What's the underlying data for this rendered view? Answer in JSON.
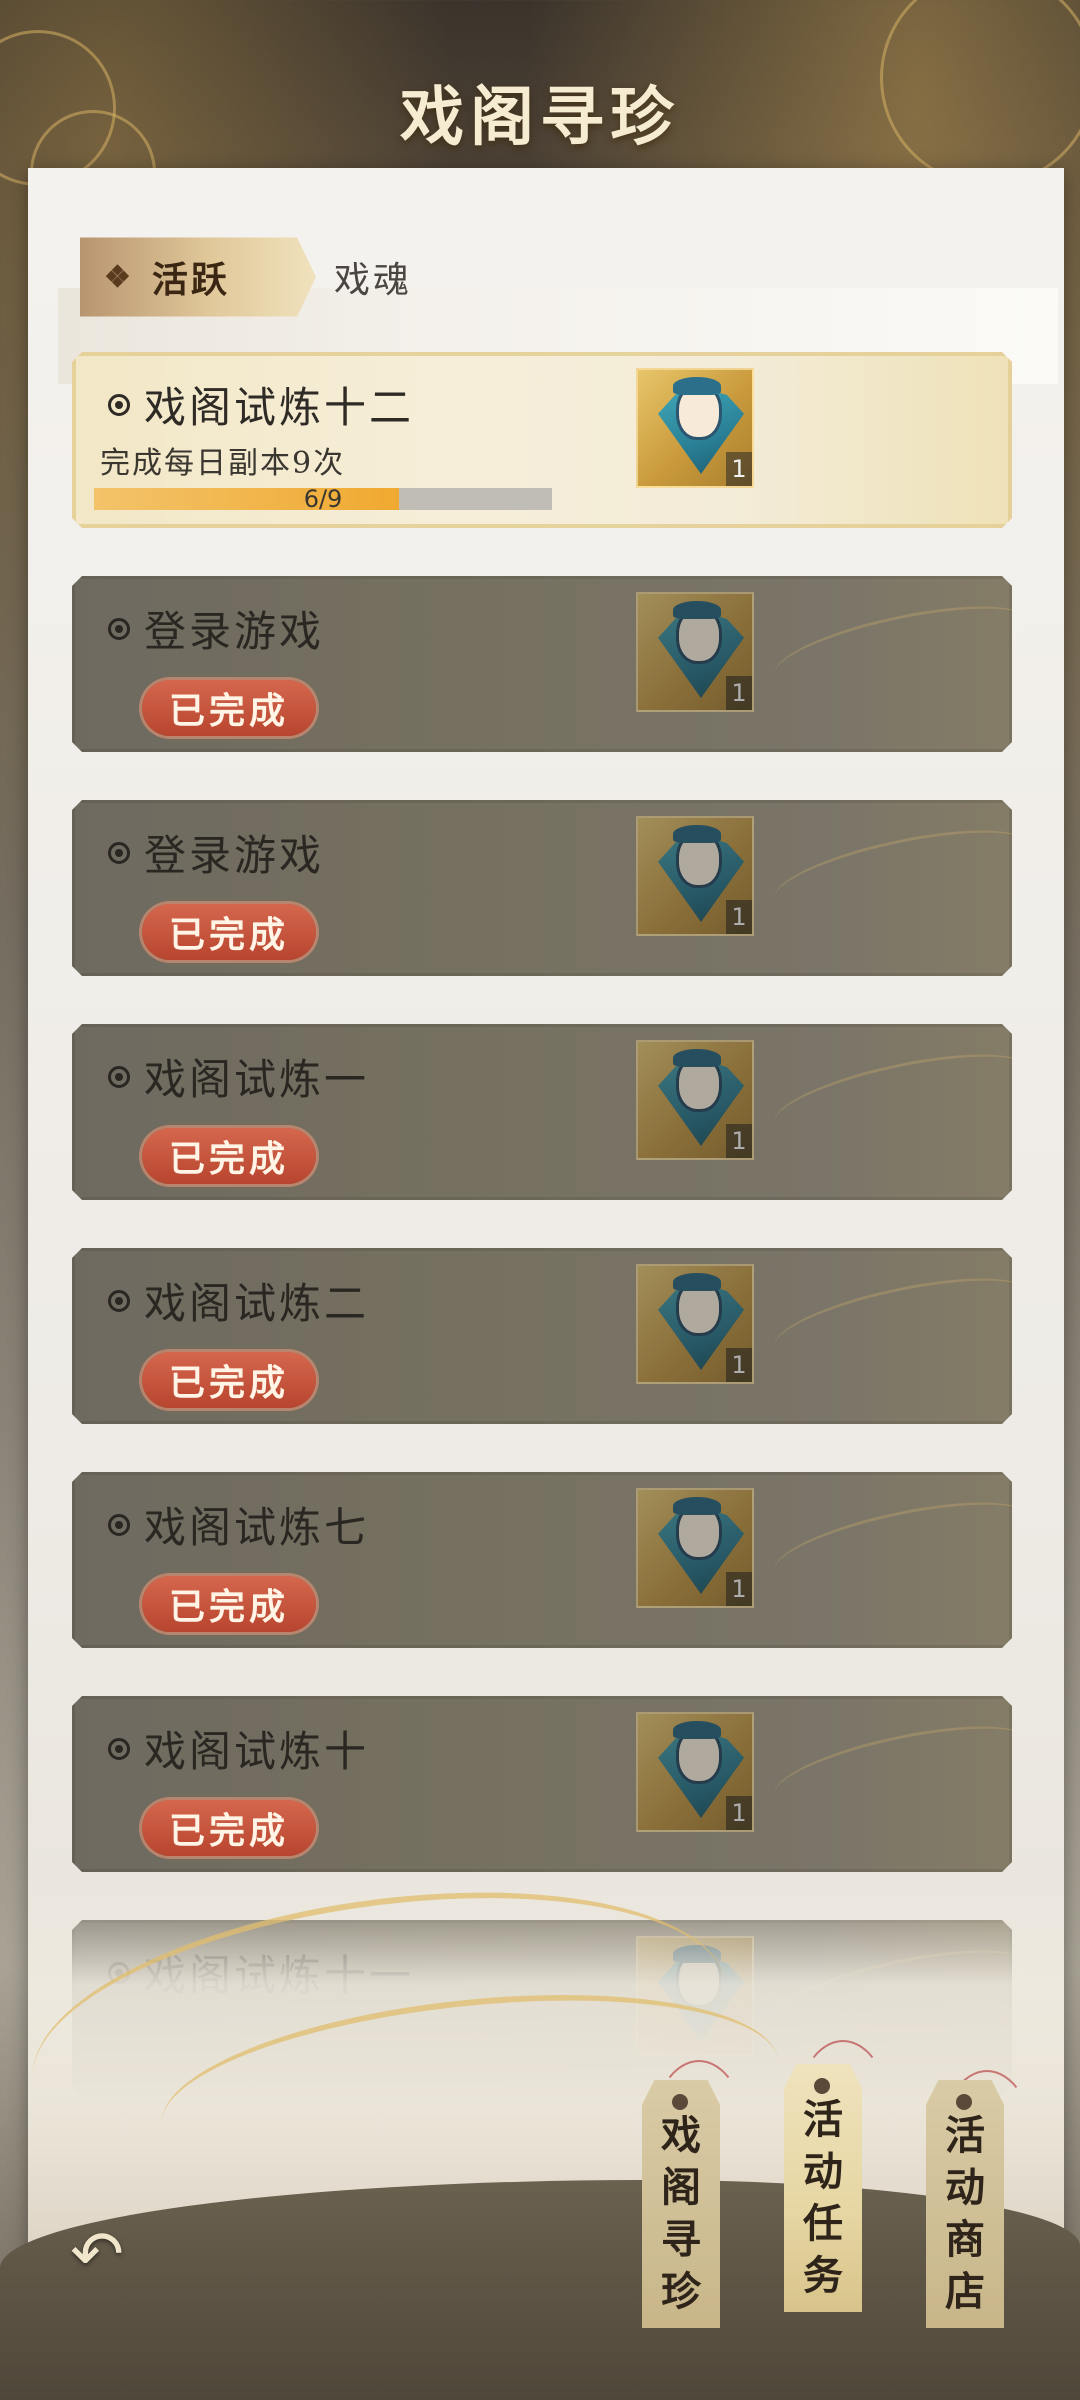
{
  "header": {
    "title": "戏阁寻珍"
  },
  "tabs": [
    {
      "label": "活跃",
      "active": true,
      "icon": "diamond-icon"
    },
    {
      "label": "戏魂",
      "active": false
    }
  ],
  "tasks": [
    {
      "title": "戏阁试炼十二",
      "description": "完成每日副本9次",
      "progress_text": "6/9",
      "progress": 0.667,
      "status": "in-progress",
      "reward_count": "1"
    },
    {
      "title": "登录游戏",
      "status_label": "已完成",
      "status": "done",
      "reward_count": "1"
    },
    {
      "title": "登录游戏",
      "status_label": "已完成",
      "status": "done",
      "reward_count": "1"
    },
    {
      "title": "戏阁试炼一",
      "status_label": "已完成",
      "status": "done",
      "reward_count": "1"
    },
    {
      "title": "戏阁试炼二",
      "status_label": "已完成",
      "status": "done",
      "reward_count": "1"
    },
    {
      "title": "戏阁试炼七",
      "status_label": "已完成",
      "status": "done",
      "reward_count": "1"
    },
    {
      "title": "戏阁试炼十",
      "status_label": "已完成",
      "status": "done",
      "reward_count": "1"
    },
    {
      "title": "戏阁试炼十一",
      "status": "done",
      "reward_count": "1"
    }
  ],
  "bottom_nav": [
    {
      "label": "戏阁寻珍",
      "chars": [
        "戏",
        "阁",
        "寻",
        "珍"
      ]
    },
    {
      "label": "活动任务",
      "chars": [
        "活",
        "动",
        "任",
        "务"
      ]
    },
    {
      "label": "活动商店",
      "chars": [
        "活",
        "动",
        "商",
        "店"
      ]
    }
  ],
  "icons": {
    "back": "back-arrow-icon",
    "reward": "opera-fan-reward-icon"
  },
  "colors": {
    "accent_gold": "#f0a930",
    "done_badge": "#c4503a",
    "title_text": "#f6ecd2"
  }
}
